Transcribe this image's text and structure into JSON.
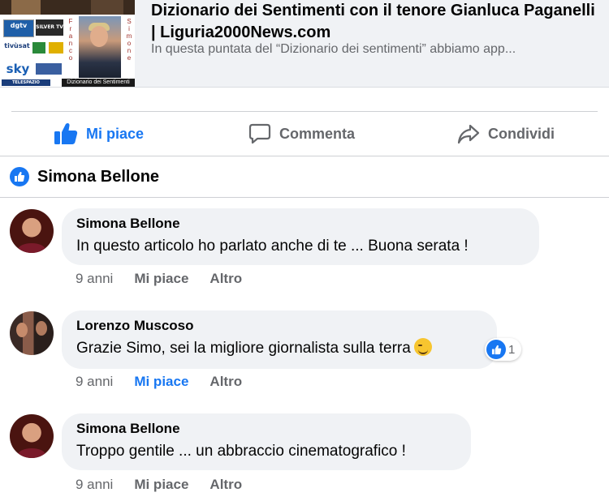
{
  "preview": {
    "title": "Dizionario dei Sentimenti con il tenore Gianluca Paganelli | Liguria2000News.com",
    "description": "In questa puntata del “Dizionario dei sentimenti” abbiamo app...",
    "thumbnail": {
      "logos": [
        "dgtv",
        "SILVER TV",
        "tivùsat",
        "sky",
        "TELESPAZIO"
      ],
      "side_text_left": "Franco",
      "side_text_right": "Simone",
      "caption": "Dizionario dei Sentimenti"
    }
  },
  "actions": {
    "like": "Mi piace",
    "comment": "Commenta",
    "share": "Condividi"
  },
  "likers": {
    "name": "Simona Bellone"
  },
  "comments": [
    {
      "author": "Simona Bellone",
      "text": "In questo articolo ho parlato anche di te ... Buona serata !",
      "time": "9 anni",
      "like_label": "Mi piace",
      "more_label": "Altro",
      "liked": false
    },
    {
      "author": "Lorenzo Muscoso",
      "text": "Grazie Simo, sei la migliore giornalista sulla terra",
      "time": "9 anni",
      "like_label": "Mi piace",
      "more_label": "Altro",
      "liked": true,
      "reaction_count": "1"
    },
    {
      "author": "Simona Bellone",
      "text": "Troppo gentile ... un abbraccio cinematografico !",
      "time": "9 anni",
      "like_label": "Mi piace",
      "more_label": "Altro",
      "liked": false
    }
  ],
  "colors": {
    "accent": "#1877f2",
    "muted": "#65676b",
    "bubble": "#f0f2f5"
  }
}
